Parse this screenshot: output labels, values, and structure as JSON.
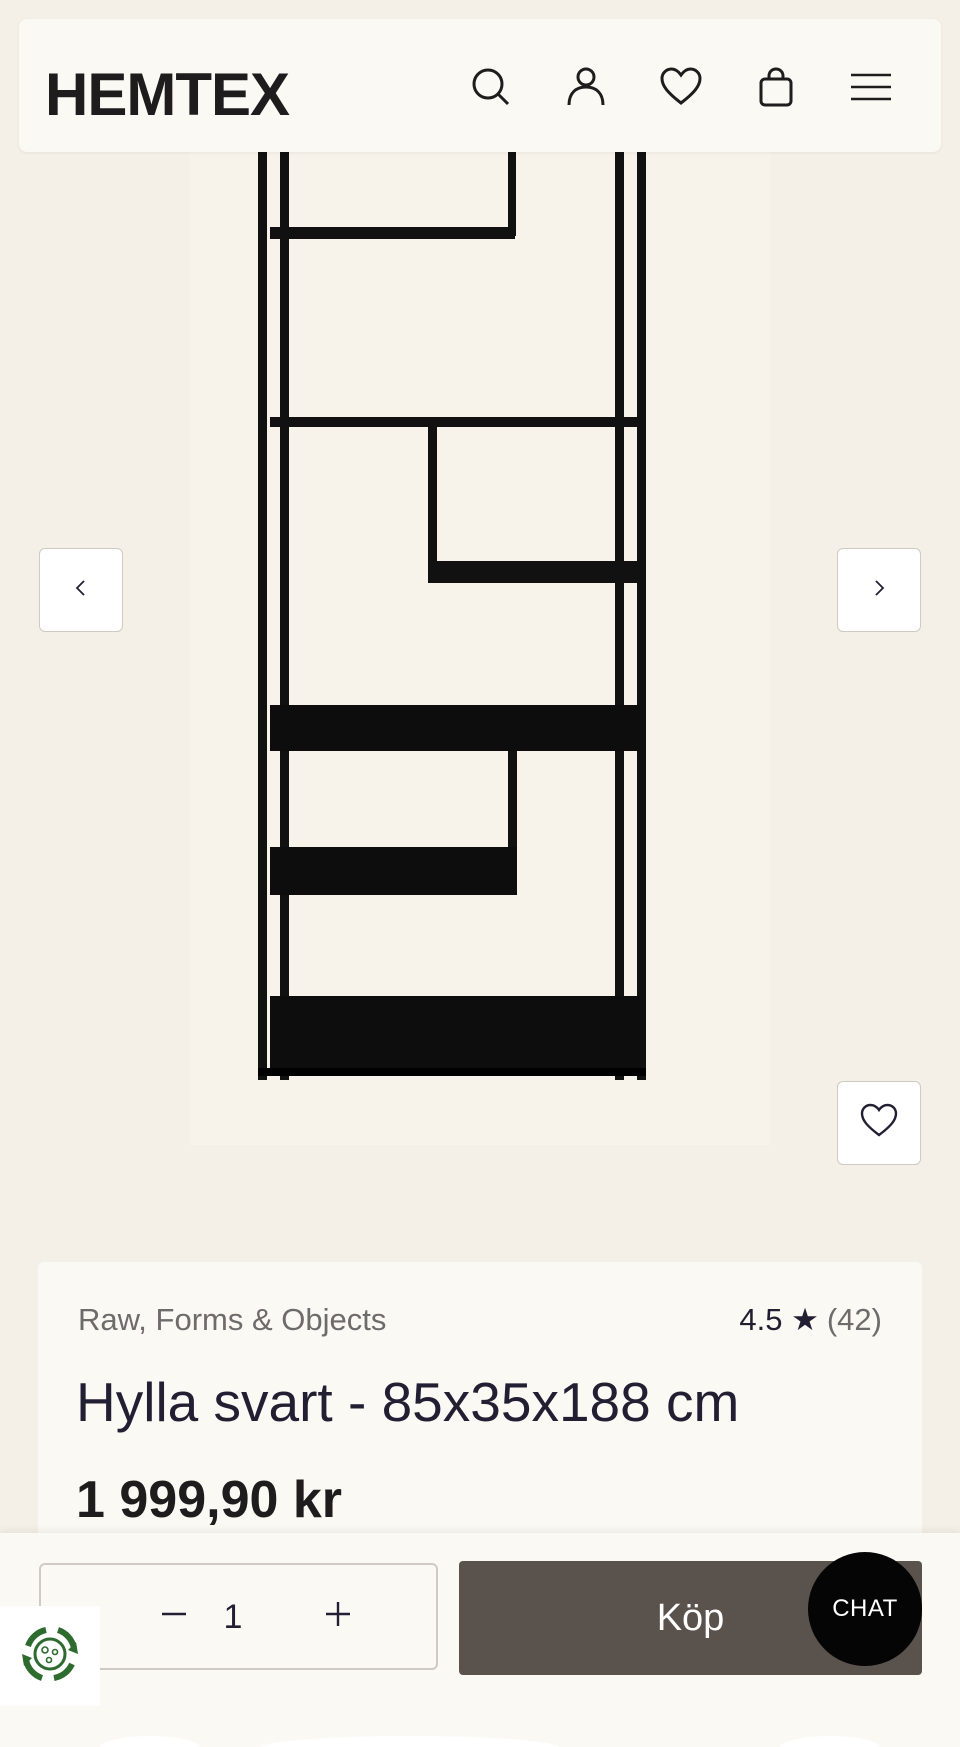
{
  "header": {
    "logo": "HEMTEX",
    "icons": [
      "search-icon",
      "user-icon",
      "heart-icon",
      "bag-icon",
      "menu-icon"
    ]
  },
  "gallery": {
    "prev_icon": "chevron-left-icon",
    "next_icon": "chevron-right-icon",
    "wishlist_icon": "heart-icon"
  },
  "product": {
    "brand": "Raw, Forms & Objects",
    "rating": "4.5 ★",
    "rating_count": "(42)",
    "title": "Hylla svart - 85x35x188 cm",
    "price": "1 999,90 kr"
  },
  "cart": {
    "quantity": "1",
    "decrease_icon": "minus-icon",
    "increase_icon": "plus-icon",
    "buy_label": "Köp",
    "chat_label": "CHAT"
  },
  "colors": {
    "background": "#f4f0e8",
    "surface": "#fbf9f4",
    "buy_button": "#5a524c",
    "chat_button": "#050505",
    "text": "#221f33",
    "eco_green": "#2e6b2e"
  }
}
